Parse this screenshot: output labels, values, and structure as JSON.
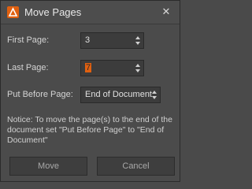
{
  "window": {
    "title": "Move Pages",
    "close_glyph": "✕",
    "app_icon": "adobe-acrobat-icon",
    "accent_color": "#e06010"
  },
  "form": {
    "first_page": {
      "label": "First Page:",
      "value": "3"
    },
    "last_page": {
      "label": "Last Page:",
      "value": "7"
    },
    "put_before": {
      "label": "Put Before Page:",
      "value": "End of Document"
    }
  },
  "notice": "Notice: To move the page(s) to the end of the document set \"Put Before Page\" to \"End of Document\"",
  "buttons": {
    "move": "Move",
    "cancel": "Cancel"
  }
}
